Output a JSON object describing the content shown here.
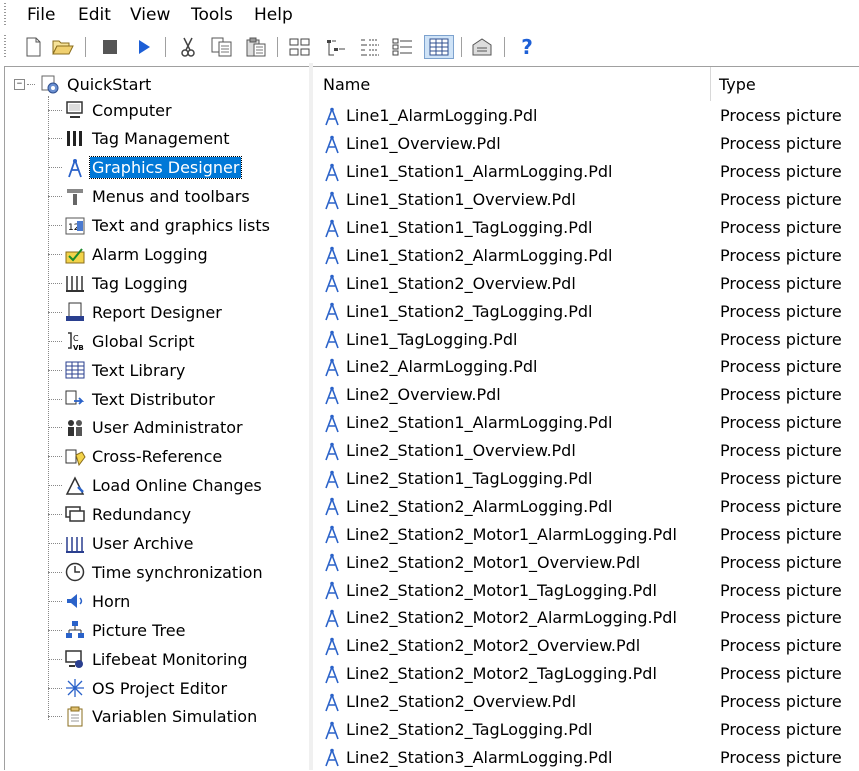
{
  "menu": {
    "file": "File",
    "edit": "Edit",
    "view": "View",
    "tools": "Tools",
    "help": "Help"
  },
  "toolbar": {
    "icons": [
      "new-icon",
      "open-icon",
      "stop-icon",
      "run-icon",
      "cut-icon",
      "copy-icon",
      "paste-icon",
      "large-icons-icon",
      "small-icons-icon",
      "list-icon",
      "details-icon",
      "details-active-icon",
      "properties-icon",
      "help-icon"
    ]
  },
  "tree": {
    "root": "QuickStart",
    "items": [
      {
        "label": "Computer",
        "icon": "computer-icon"
      },
      {
        "label": "Tag Management",
        "icon": "tag-management-icon"
      },
      {
        "label": "Graphics Designer",
        "icon": "graphics-designer-icon",
        "selected": true
      },
      {
        "label": "Menus and toolbars",
        "icon": "menus-toolbars-icon"
      },
      {
        "label": "Text and graphics lists",
        "icon": "text-graphics-lists-icon"
      },
      {
        "label": "Alarm Logging",
        "icon": "alarm-logging-icon"
      },
      {
        "label": "Tag Logging",
        "icon": "tag-logging-icon"
      },
      {
        "label": "Report Designer",
        "icon": "report-designer-icon"
      },
      {
        "label": "Global Script",
        "icon": "global-script-icon"
      },
      {
        "label": "Text Library",
        "icon": "text-library-icon"
      },
      {
        "label": "Text Distributor",
        "icon": "text-distributor-icon"
      },
      {
        "label": "User Administrator",
        "icon": "user-administrator-icon"
      },
      {
        "label": "Cross-Reference",
        "icon": "cross-reference-icon"
      },
      {
        "label": "Load Online Changes",
        "icon": "load-online-changes-icon"
      },
      {
        "label": "Redundancy",
        "icon": "redundancy-icon"
      },
      {
        "label": "User Archive",
        "icon": "user-archive-icon"
      },
      {
        "label": "Time synchronization",
        "icon": "clock-icon"
      },
      {
        "label": "Horn",
        "icon": "horn-icon"
      },
      {
        "label": "Picture Tree",
        "icon": "picture-tree-icon"
      },
      {
        "label": "Lifebeat Monitoring",
        "icon": "lifebeat-monitoring-icon"
      },
      {
        "label": "OS Project Editor",
        "icon": "os-project-editor-icon"
      },
      {
        "label": "Variablen Simulation",
        "icon": "variablen-simulation-icon"
      }
    ]
  },
  "list": {
    "columns": {
      "name": "Name",
      "type": "Type"
    },
    "rows": [
      {
        "name": "Line1_AlarmLogging.Pdl",
        "type": "Process picture"
      },
      {
        "name": "Line1_Overview.Pdl",
        "type": "Process picture"
      },
      {
        "name": "Line1_Station1_AlarmLogging.Pdl",
        "type": "Process picture"
      },
      {
        "name": "Line1_Station1_Overview.Pdl",
        "type": "Process picture"
      },
      {
        "name": "Line1_Station1_TagLogging.Pdl",
        "type": "Process picture"
      },
      {
        "name": "Line1_Station2_AlarmLogging.Pdl",
        "type": "Process picture"
      },
      {
        "name": "Line1_Station2_Overview.Pdl",
        "type": "Process picture"
      },
      {
        "name": "Line1_Station2_TagLogging.Pdl",
        "type": "Process picture"
      },
      {
        "name": "Line1_TagLogging.Pdl",
        "type": "Process picture"
      },
      {
        "name": "Line2_AlarmLogging.Pdl",
        "type": "Process picture"
      },
      {
        "name": "Line2_Overview.Pdl",
        "type": "Process picture"
      },
      {
        "name": "Line2_Station1_AlarmLogging.Pdl",
        "type": "Process picture"
      },
      {
        "name": "Line2_Station1_Overview.Pdl",
        "type": "Process picture"
      },
      {
        "name": "Line2_Station1_TagLogging.Pdl",
        "type": "Process picture"
      },
      {
        "name": "Line2_Station2_AlarmLogging.Pdl",
        "type": "Process picture"
      },
      {
        "name": "Line2_Station2_Motor1_AlarmLogging.Pdl",
        "type": "Process picture"
      },
      {
        "name": "Line2_Station2_Motor1_Overview.Pdl",
        "type": "Process picture"
      },
      {
        "name": "Line2_Station2_Motor1_TagLogging.Pdl",
        "type": "Process picture"
      },
      {
        "name": "Line2_Station2_Motor2_AlarmLogging.Pdl",
        "type": "Process picture"
      },
      {
        "name": "Line2_Station2_Motor2_Overview.Pdl",
        "type": "Process picture"
      },
      {
        "name": "Line2_Station2_Motor2_TagLogging.Pdl",
        "type": "Process picture"
      },
      {
        "name": "LIne2_Station2_Overview.Pdl",
        "type": "Process picture"
      },
      {
        "name": "Line2_Station2_TagLogging.Pdl",
        "type": "Process picture"
      },
      {
        "name": "Line2_Station3_AlarmLogging.Pdl",
        "type": "Process picture"
      }
    ]
  },
  "colors": {
    "selection": "#0078d7",
    "pdl_icon": "#2a62c9",
    "help_icon": "#1d5fd6"
  }
}
